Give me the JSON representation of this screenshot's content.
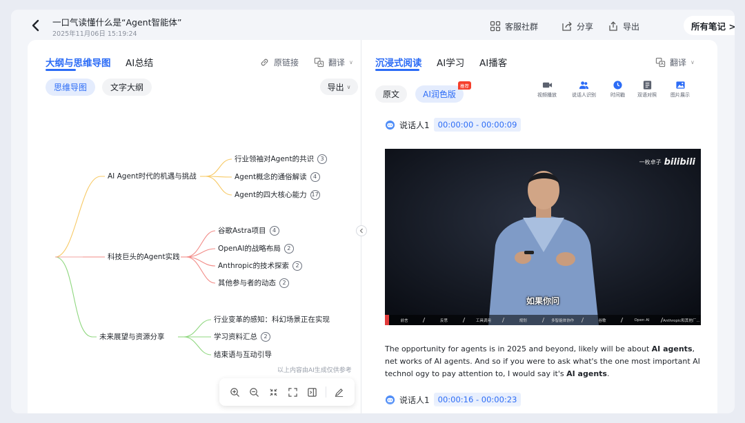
{
  "header": {
    "title": "一口气读懂什么是“Agent智能体”",
    "datetime": "2025年11月06日 15:19:24",
    "service_group": "客服社群",
    "share": "分享",
    "export": "导出",
    "all_notes": "所有笔记 >"
  },
  "left": {
    "tabs": [
      "大纲与思维导图",
      "AI总结"
    ],
    "original_link": "原链接",
    "translate": "翻译",
    "chips": [
      "思维导图",
      "文字大纲"
    ],
    "export": "导出",
    "mindmap": {
      "branches": [
        {
          "label": "AI Agent时代的机遇与挑战",
          "color": "#f7c964",
          "children": [
            {
              "label": "行业领袖对Agent的共识",
              "count": "3"
            },
            {
              "label": "Agent概念的通俗解读",
              "count": "4"
            },
            {
              "label": "Agent的四大核心能力",
              "count": "17"
            }
          ]
        },
        {
          "label": "科技巨头的Agent实践",
          "color": "#f28a86",
          "children": [
            {
              "label": "谷歌Astra项目",
              "count": "4"
            },
            {
              "label": "OpenAI的战略布局",
              "count": "2"
            },
            {
              "label": "Anthropic的技术探索",
              "count": "2"
            },
            {
              "label": "其他参与者的动态",
              "count": "2"
            }
          ]
        },
        {
          "label": "未来展望与资源分享",
          "color": "#8fd77f",
          "children": [
            {
              "label": "行业变革的感知：科幻场景正在实现",
              "count": ""
            },
            {
              "label": "学习资料汇总",
              "count": "2"
            },
            {
              "label": "结束语与互动引导",
              "count": ""
            }
          ]
        }
      ]
    },
    "ai_note": "以上内容由AI生成仅供参考"
  },
  "right": {
    "tabs": [
      "沉浸式阅读",
      "AI学习",
      "AI播客"
    ],
    "translate": "翻译",
    "chips": [
      "原文",
      "AI润色版"
    ],
    "recommend_tag": "推荐",
    "tools": [
      {
        "label": "视频播放",
        "icon": "video-camera-icon"
      },
      {
        "label": "说话人识别",
        "icon": "speaker-id-icon"
      },
      {
        "label": "时间戳",
        "icon": "clock-icon"
      },
      {
        "label": "双语对照",
        "icon": "bilingual-icon"
      },
      {
        "label": "图片展示",
        "icon": "image-icon"
      }
    ],
    "speaker1": {
      "name": "说话人1",
      "time": "00:00:00 - 00:00:09"
    },
    "speaker2": {
      "name": "说话人1",
      "time": "00:00:16 - 00:00:23"
    },
    "video": {
      "watermark_prefix": "一枚卓子",
      "watermark_brand": "bilibili",
      "subtitle": "如果你问",
      "chapters": [
        "前言",
        "反思",
        "工具调用",
        "规划",
        "多智能体协作",
        "谷歌",
        "Open AI",
        "Anthropic和其他厂..."
      ]
    },
    "transcript": {
      "p1": "The opportunity for agents is in 2025 and beyond,  likely will be about ",
      "b1": "AI agents",
      "p2": ",  net works of AI agents. And so if you were to ask what's the one most important AI technol ogy to pay attention to,  I would say it's ",
      "b2": "AI agents",
      "p3": "."
    }
  },
  "colors": {
    "accent": "#2c6cf6",
    "badge_red": "#f5402c"
  }
}
